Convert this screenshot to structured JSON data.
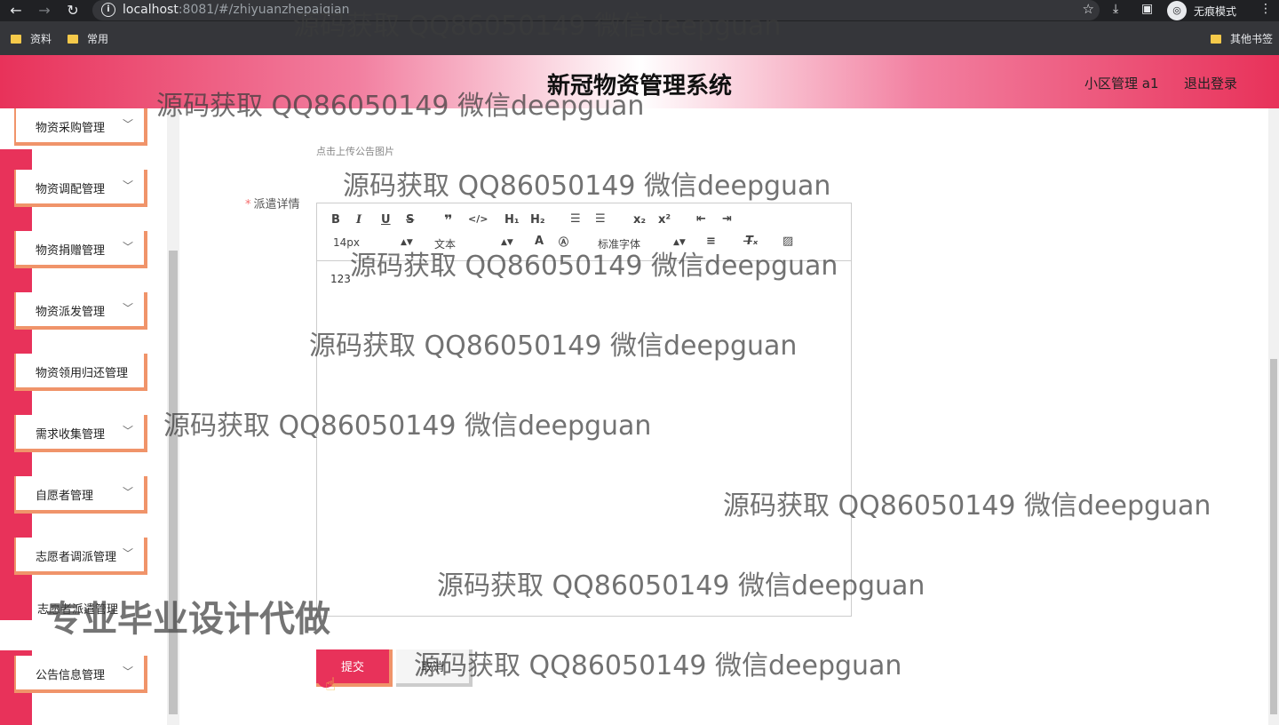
{
  "browser": {
    "url_host": "localhost",
    "url_rest": ":8081/#/zhiyuanzhepaiqian",
    "incognito_label": "无痕模式",
    "bookmarks": [
      "资料",
      "常用"
    ],
    "other_bookmarks": "其他书签"
  },
  "header": {
    "title": "新冠物资管理系统",
    "user": "小区管理 a1",
    "logout": "退出登录"
  },
  "sidebar": {
    "items": [
      {
        "label": "物资采购管理"
      },
      {
        "label": "物资调配管理"
      },
      {
        "label": "物资捐赠管理"
      },
      {
        "label": "物资派发管理"
      },
      {
        "label": "物资领用归还管理"
      },
      {
        "label": "需求收集管理"
      },
      {
        "label": "自愿者管理"
      },
      {
        "label": "志愿者调派管理"
      },
      {
        "label": "志愿者派遣管理"
      },
      {
        "label": "公告信息管理"
      }
    ]
  },
  "form": {
    "upload_hint": "点击上传公告图片",
    "detail_label": "派遣详情",
    "editor": {
      "font_size": "14px",
      "text_type": "文本",
      "font_family": "标准字体",
      "content": "123"
    },
    "submit": "提交",
    "cancel": "取消"
  },
  "watermarks": {
    "text": "源码获取 QQ86050149 微信deepguan",
    "banner": "专业毕业设计代做"
  }
}
